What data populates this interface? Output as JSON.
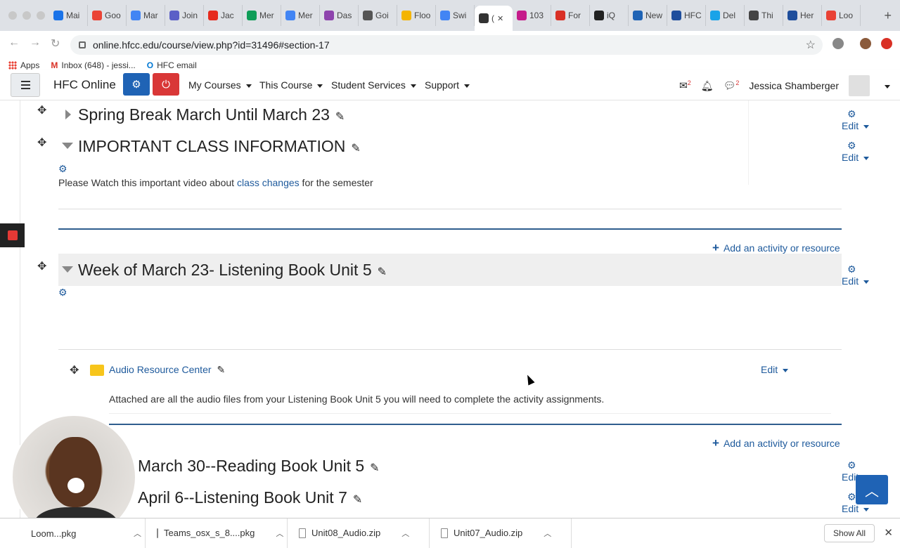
{
  "browser": {
    "tabs": [
      {
        "label": "Mai",
        "color": "#1a73e8"
      },
      {
        "label": "Goo",
        "color": "#ea4335"
      },
      {
        "label": "Mar",
        "color": "#4285f4"
      },
      {
        "label": "Join",
        "color": "#5b5fc7"
      },
      {
        "label": "Jac",
        "color": "#e62b1e"
      },
      {
        "label": "Mer",
        "color": "#0f9d58"
      },
      {
        "label": "Mer",
        "color": "#4285f4"
      },
      {
        "label": "Das",
        "color": "#8e44ad"
      },
      {
        "label": "Goi",
        "color": "#555555"
      },
      {
        "label": "Floo",
        "color": "#f4b400"
      },
      {
        "label": "Swi",
        "color": "#4285f4"
      },
      {
        "label": "(",
        "color": "#333333"
      },
      {
        "label": "103",
        "color": "#c51b8a"
      },
      {
        "label": "For",
        "color": "#d93025"
      },
      {
        "label": "iQ",
        "color": "#222222"
      },
      {
        "label": "New",
        "color": "#1f63b5"
      },
      {
        "label": "HFC",
        "color": "#1f4e9c"
      },
      {
        "label": "Del",
        "color": "#1aa3e8"
      },
      {
        "label": "Thi",
        "color": "#444444"
      },
      {
        "label": "Her",
        "color": "#1f4e9c"
      },
      {
        "label": "Loo",
        "color": "#e94235"
      }
    ],
    "active_tab_index": 11,
    "url": "online.hfcc.edu/course/view.php?id=31496#section-17",
    "bookmarks": [
      {
        "label": "Apps"
      },
      {
        "label": "Inbox (648) - jessi..."
      },
      {
        "label": "HFC email"
      }
    ]
  },
  "nav": {
    "brand": "HFC Online",
    "menus": [
      "My Courses",
      "This Course",
      "Student Services",
      "Support"
    ],
    "user_name": "Jessica Shamberger",
    "message_badge": "2",
    "notif_badge": "2"
  },
  "sections": [
    {
      "title": "Spring Break March Until March 23",
      "edit": "Edit"
    },
    {
      "title": "IMPORTANT CLASS INFORMATION",
      "edit": "Edit",
      "summary_before": "Please Watch this important video about ",
      "summary_link": "class changes",
      "summary_after": " for the semester"
    },
    {
      "title": "Week of March 23- Listening Book Unit 5",
      "edit": "Edit"
    },
    {
      "title": "March 30--Reading Book Unit 5",
      "edit": "Edit"
    },
    {
      "title": "April 6--Listening Book Unit 7",
      "edit": "Edit"
    }
  ],
  "activity": {
    "name": "Audio Resource Center",
    "edit": "Edit",
    "description": "Attached are all the audio files from your Listening Book Unit 5 you will need to complete the activity assignments."
  },
  "add_activity_label": "Add an activity or resource",
  "downloads": {
    "items": [
      {
        "label": "Loom...pkg"
      },
      {
        "label": "Teams_osx_s_8....pkg"
      },
      {
        "label": "Unit08_Audio.zip"
      },
      {
        "label": "Unit07_Audio.zip"
      }
    ],
    "show_all": "Show All"
  },
  "colors": {
    "link": "#1e5a9c",
    "settings_button": "#1f63b5",
    "logout_button": "#d93737",
    "section_divider": "#2f5e8e"
  }
}
